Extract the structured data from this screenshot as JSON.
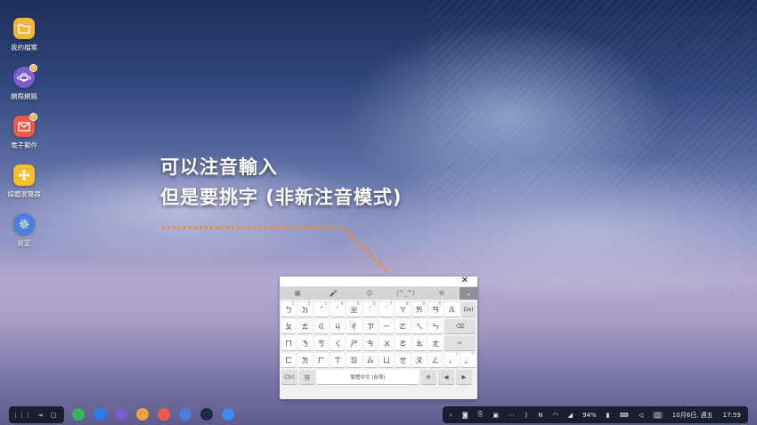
{
  "desktop": {
    "icons": [
      {
        "label": "我的檔案",
        "icon": "folder-icon",
        "color": "#f4b63a",
        "badge": ""
      },
      {
        "label": "網際網路",
        "icon": "internet-planet-icon",
        "color": "#7c5ccf",
        "badge": "5"
      },
      {
        "label": "電子郵件",
        "icon": "email-icon",
        "color": "#ee5a4a",
        "badge": "5"
      },
      {
        "label": "媒體瀏覽器",
        "icon": "media-browser-icon",
        "color": "#f5c024",
        "badge": ""
      },
      {
        "label": "設定",
        "icon": "settings-gear-icon",
        "color": "#4a7fe0",
        "badge": ""
      }
    ]
  },
  "caption": {
    "line1": "可以注音輸入",
    "line2": "但是要挑字 (非新注音模式)",
    "arrow_color": "#f28a1e"
  },
  "keyboard": {
    "close": "✕",
    "toolbar": [
      "▦",
      "🎤",
      "☺",
      "(^_^)",
      "⚙",
      "⌄"
    ],
    "row1": [
      [
        "ㄅ",
        "1"
      ],
      [
        "ㄉ",
        "2"
      ],
      [
        "ˇ",
        "3"
      ],
      [
        "ˋ",
        "4"
      ],
      [
        "ㄓ",
        "5"
      ],
      [
        "ˊ",
        "6"
      ],
      [
        "˙",
        "7"
      ],
      [
        "ㄚ",
        "8"
      ],
      [
        "ㄞ",
        "9"
      ],
      [
        "ㄢ",
        "0"
      ],
      [
        "ㄦ",
        ""
      ],
      [
        "Del",
        ""
      ]
    ],
    "row2": [
      [
        "ㄆ",
        ""
      ],
      [
        "ㄊ",
        ""
      ],
      [
        "ㄍ",
        ""
      ],
      [
        "ㄐ",
        ""
      ],
      [
        "ㄔ",
        ""
      ],
      [
        "ㄗ",
        ""
      ],
      [
        "ㄧ",
        ""
      ],
      [
        "ㄛ",
        ""
      ],
      [
        "ㄟ",
        ""
      ],
      [
        "ㄣ",
        ""
      ],
      [
        "⌫",
        ""
      ]
    ],
    "row3": [
      [
        "ㄇ",
        ""
      ],
      [
        "ㄋ",
        ""
      ],
      [
        "ㄎ",
        ""
      ],
      [
        "ㄑ",
        ""
      ],
      [
        "ㄕ",
        ""
      ],
      [
        "ㄘ",
        ""
      ],
      [
        "ㄨ",
        ""
      ],
      [
        "ㄜ",
        ""
      ],
      [
        "ㄠ",
        ""
      ],
      [
        "ㄤ",
        ""
      ],
      [
        "↵",
        ""
      ]
    ],
    "row4": [
      [
        "ㄈ",
        ""
      ],
      [
        "ㄌ",
        ""
      ],
      [
        "ㄏ",
        ""
      ],
      [
        "ㄒ",
        ""
      ],
      [
        "ㄖ",
        ""
      ],
      [
        "ㄙ",
        ""
      ],
      [
        "ㄩ",
        ""
      ],
      [
        "ㄝ",
        ""
      ],
      [
        "ㄡ",
        ""
      ],
      [
        "ㄥ",
        ""
      ],
      [
        "，",
        "!"
      ],
      [
        "。",
        "?"
      ]
    ],
    "row5": {
      "ctrl": "Ctrl",
      "sym": "符",
      "space": "繁體中文 (台灣)",
      "globe": "⊕",
      "left": "◀",
      "right": "▶"
    }
  },
  "taskbar": {
    "left": [
      "grid-icon",
      "recent-apps-icon",
      "multi-window-icon"
    ],
    "apps": [
      {
        "icon": "phone-icon",
        "color": "#36b55a"
      },
      {
        "icon": "messenger-icon",
        "color": "#2a7cf0"
      },
      {
        "icon": "internet-planet-icon",
        "color": "#7c5ccf"
      },
      {
        "icon": "gallery-flower-icon",
        "color": "#e9a53a"
      },
      {
        "icon": "email-icon",
        "color": "#ee5a4a"
      },
      {
        "icon": "settings-gear-icon",
        "color": "#4a7fe0"
      },
      {
        "icon": "speedometer-icon",
        "color": "#1d2a44"
      },
      {
        "icon": "camera-icon",
        "color": "#3d8be8"
      }
    ],
    "tray": {
      "battery": "94%",
      "date": "10月6日, 週五",
      "time": "17:59"
    }
  }
}
